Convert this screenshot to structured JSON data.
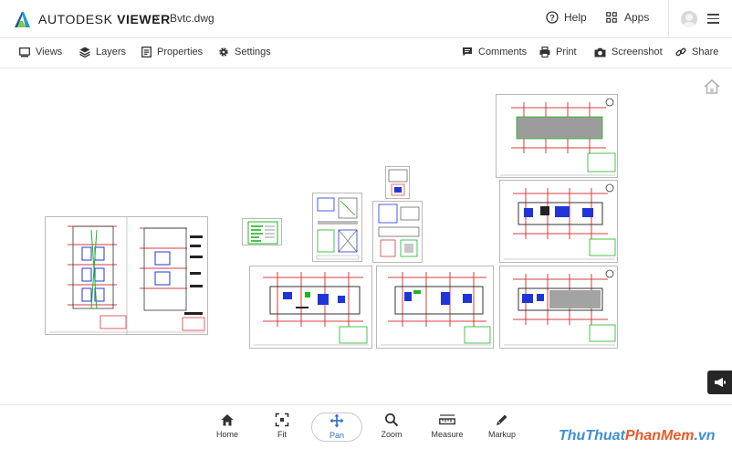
{
  "header": {
    "brand_light": "AUTODESK",
    "brand_bold": "VIEWER",
    "file_name": "Bvtc.dwg",
    "help_label": "Help",
    "apps_label": "Apps"
  },
  "toolbar": {
    "views_label": "Views",
    "layers_label": "Layers",
    "properties_label": "Properties",
    "settings_label": "Settings",
    "comments_label": "Comments",
    "print_label": "Print",
    "screenshot_label": "Screenshot",
    "share_label": "Share"
  },
  "bottom_tools": {
    "home_label": "Home",
    "fit_label": "Fit",
    "pan_label": "Pan",
    "zoom_label": "Zoom",
    "measure_label": "Measure",
    "markup_label": "Markup",
    "active_tool": "Pan"
  },
  "watermark": {
    "part1": "ThuThuat",
    "part2": "PhanMem",
    "part3": ".vn"
  },
  "colors": {
    "accent": "#2a6fc9",
    "drawing_red": "#d63c3c",
    "drawing_blue": "#2035d8",
    "drawing_green": "#1fb51f"
  }
}
